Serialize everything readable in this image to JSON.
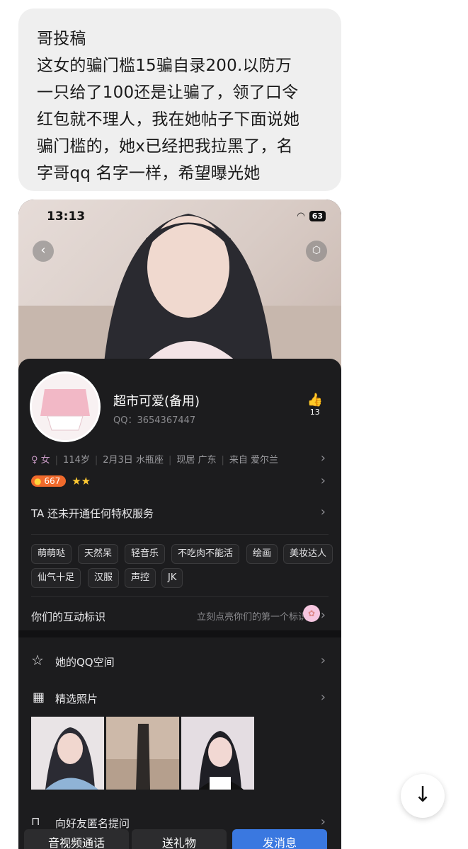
{
  "message": {
    "lines": [
      "哥投稿",
      "这女的骗门槛15骗自录200.以防万",
      "一只给了100还是让骗了，领了口令",
      "红包就不理人，我在她帖子下面说她",
      "骗门槛的，她x已经把我拉黑了，名",
      "字哥qq 名字一样，希望曝光她"
    ]
  },
  "screenshot": {
    "status": {
      "time": "13:13",
      "battery": "63"
    },
    "profile": {
      "name": "超市可爱(备用)",
      "qq": "QQ：3654367447",
      "likes": "13",
      "info": {
        "gender": "♀ 女",
        "age": "114岁",
        "birthday": "2月3日 水瓶座",
        "location": "现居 广东",
        "hometown": "来自 爱尔兰"
      },
      "level": "667",
      "privilege": "TA 还未开通任何特权服务",
      "tags": [
        "萌萌哒",
        "天然呆",
        "轻音乐",
        "不吃肉不能活",
        "绘画",
        "美妆达人",
        "仙气十足",
        "汉服",
        "声控",
        "JK"
      ],
      "interaction": {
        "label": "你们的互动标识",
        "hint": "立刻点亮你们的第一个标识"
      }
    },
    "menu": {
      "qzone": "她的QQ空间",
      "photos": "精选照片",
      "anon": "向好友匿名提问"
    },
    "buttons": {
      "call": "音视频通话",
      "gift": "送礼物",
      "message": "发消息"
    },
    "colors": {
      "accent": "#3a78e0",
      "card": "#1c1c1e"
    }
  }
}
